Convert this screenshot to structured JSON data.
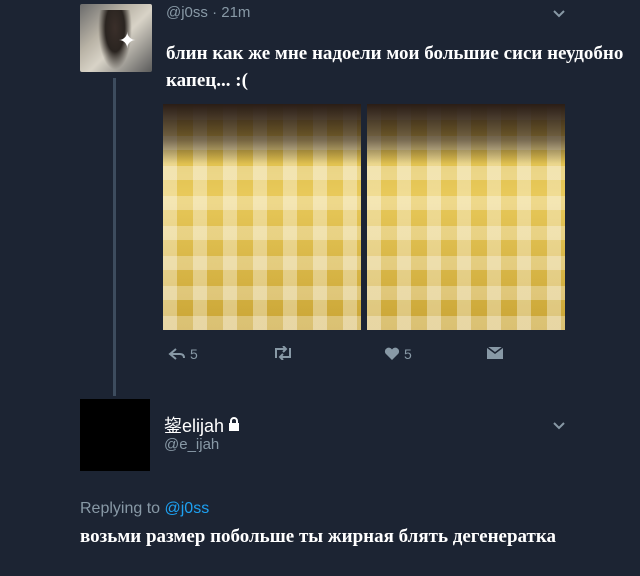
{
  "tweet": {
    "handle": "@j0ss",
    "time": "· 21m",
    "text": "блин как же мне надоели мои большие сиси неудобно капец... :(",
    "actions": {
      "reply_count": "5",
      "like_count": "5"
    },
    "icons": [
      "reply-icon",
      "retweet-icon",
      "like-icon",
      "dm-icon",
      "chevron-down-icon"
    ]
  },
  "reply": {
    "name": "鋆elijah",
    "handle": "@e_ijah",
    "replying_prefix": "Replying to",
    "replying_mention": "@j0ss",
    "text": "возьми размер побольше ты жирная блять дегенератка"
  },
  "colors": {
    "background": "#1c2433",
    "muted": "#8899a6",
    "link": "#1da1f2",
    "text": "#ffffff"
  }
}
